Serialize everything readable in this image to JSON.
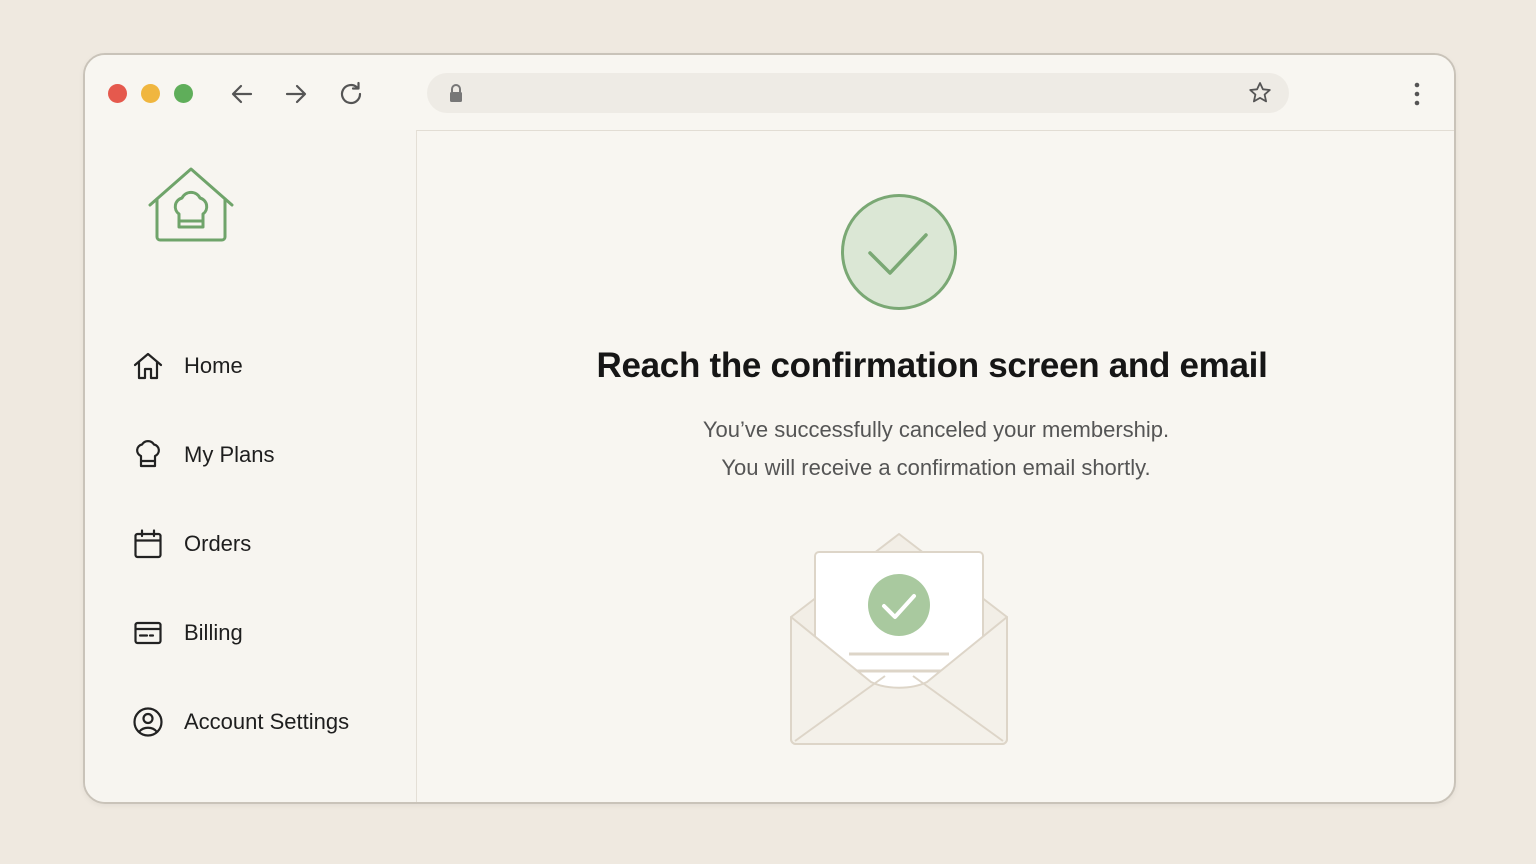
{
  "browser": {
    "url": "",
    "colors": {
      "close": "#e5594d",
      "minimize": "#f0b63f",
      "maximize": "#5fae5a"
    },
    "icons": [
      "back-arrow-icon",
      "forward-arrow-icon",
      "reload-icon",
      "lock-icon",
      "star-icon",
      "more-vertical-icon"
    ]
  },
  "sidebar": {
    "logo_icon": "chef-house-icon",
    "items": [
      {
        "label": "Home",
        "icon": "home-icon"
      },
      {
        "label": "My Plans",
        "icon": "chef-hat-icon"
      },
      {
        "label": "Orders",
        "icon": "calendar-icon"
      },
      {
        "label": "Billing",
        "icon": "card-icon"
      },
      {
        "label": "Account Settings",
        "icon": "user-circle-icon"
      }
    ]
  },
  "main": {
    "title": "Reach the confirmation screen and email",
    "message_line1": "You’ve successfully canceled your membership.",
    "message_line2": "You will receive a confirmation email shortly.",
    "success_icon": "check-circle-icon",
    "illustration": "envelope-check-icon",
    "colors": {
      "accent": "#7aa874",
      "accent_light": "#dbe7d5"
    }
  }
}
